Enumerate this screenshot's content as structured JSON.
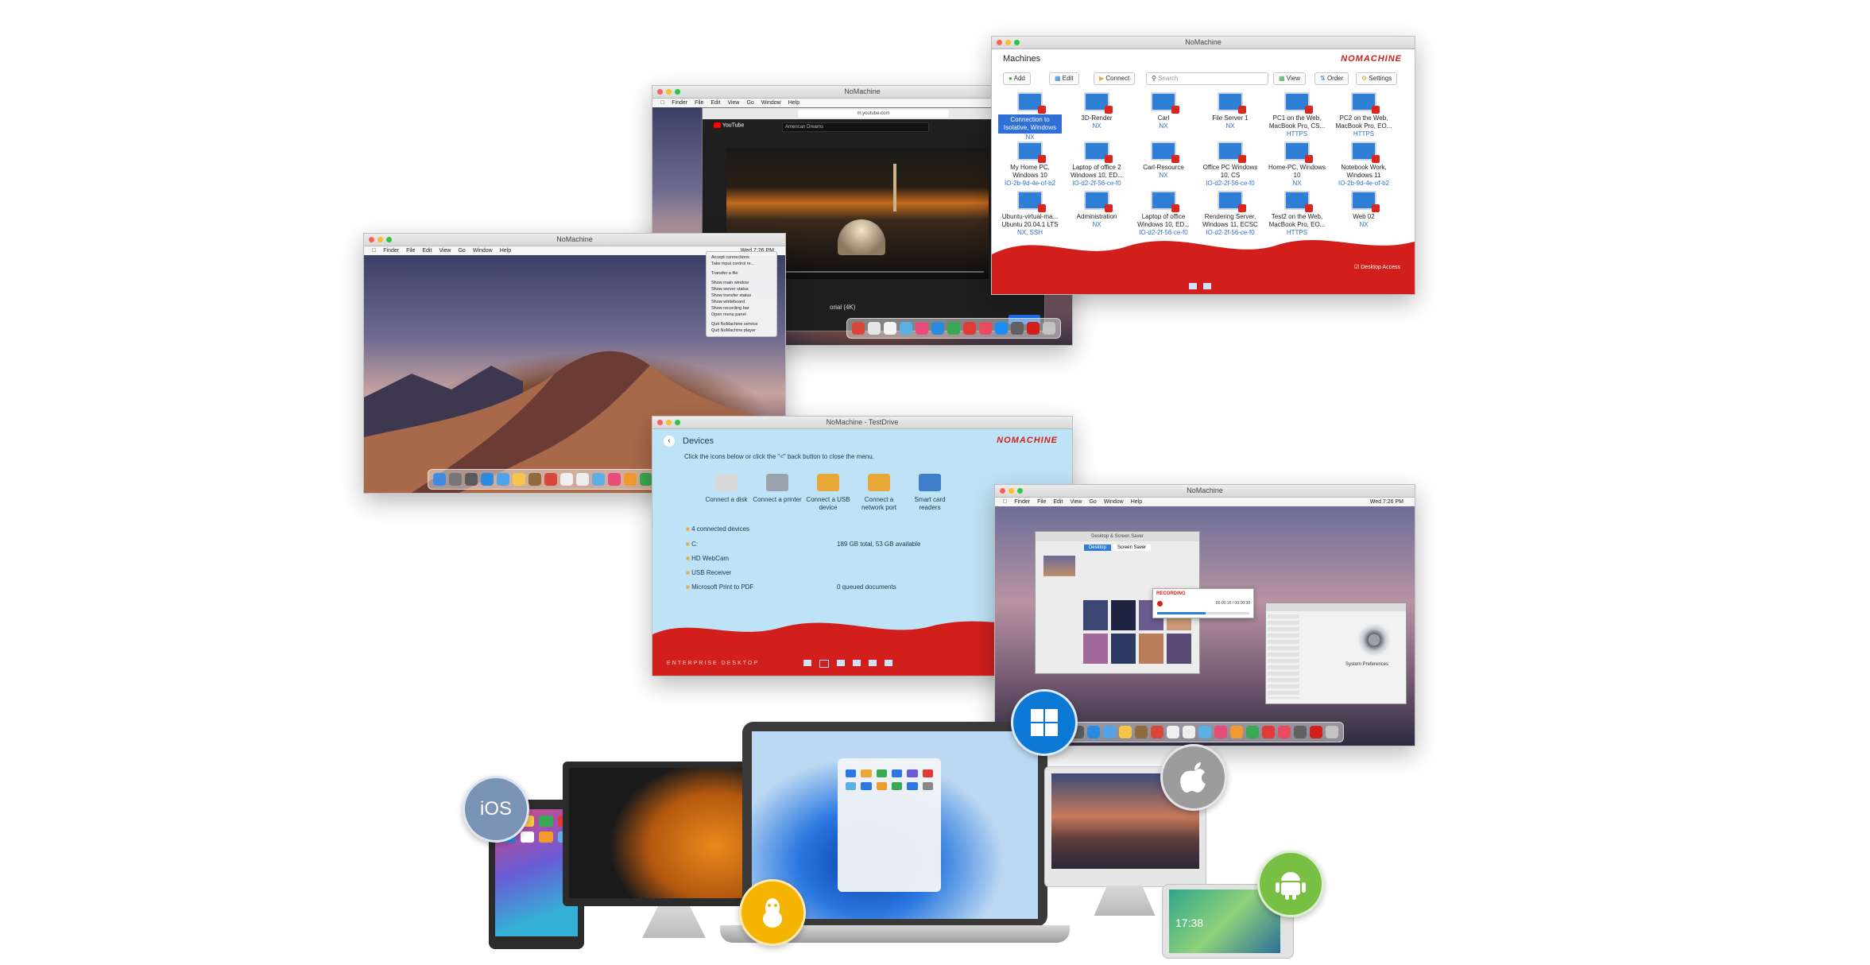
{
  "machines_window": {
    "title": "NoMachine",
    "header": "Machines",
    "brand": "NOMACHINE",
    "toolbar": {
      "add": "Add",
      "edit": "Edit",
      "connect": "Connect",
      "search_placeholder": "Search",
      "view": "View",
      "order": "Order",
      "settings": "Settings"
    },
    "machines": [
      {
        "name": "Connection to Isolative, Windows",
        "info": "NX"
      },
      {
        "name": "3D-Render",
        "info": "NX"
      },
      {
        "name": "Carl",
        "info": "NX"
      },
      {
        "name": "File Server 1",
        "info": "NX"
      },
      {
        "name": "PC1 on the Web, MacBook Pro, CS...",
        "info": "HTTPS"
      },
      {
        "name": "PC2 on the Web, MacBook Pro, EO...",
        "info": "HTTPS"
      },
      {
        "name": "My Home PC, Windows 10",
        "info": "IO-2b-9d-4e-of-b2"
      },
      {
        "name": "Laptop of office 2 Windows 10, ED...",
        "info": "IO-d2-2f-56-ce-f0"
      },
      {
        "name": "Carl-Resource",
        "info": "NX"
      },
      {
        "name": "Office PC Windows 10, CS",
        "info": "IO-d2-2f-56-ce-f0"
      },
      {
        "name": "Home-PC, Windows 10",
        "info": "NX"
      },
      {
        "name": "Notebook Work, Windows 11",
        "info": "IO-2b-9d-4e-of-b2"
      },
      {
        "name": "Ubuntu-virtual-ma... Ubuntu 20.04.1 LTS",
        "info": "NX, SSH"
      },
      {
        "name": "Administration",
        "info": "NX"
      },
      {
        "name": "Laptop of office Windows 10, ED...",
        "info": "IO-d2-2f-56-ce-f0"
      },
      {
        "name": "Rendering Server, Windows 11, ECSC",
        "info": "IO-d2-2f-56-ce-f0"
      },
      {
        "name": "Test2 on the Web, MacBook Pro, EO...",
        "info": "HTTPS"
      },
      {
        "name": "Web 02",
        "info": "NX"
      }
    ],
    "footer_checkbox": "Desktop Access"
  },
  "video_window": {
    "title": "NoMachine",
    "menu": [
      "Finder",
      "File",
      "Edit",
      "View",
      "Go",
      "Window",
      "Help"
    ],
    "url": "m.youtube.com",
    "site": "YouTube",
    "search_text": "American Dreams",
    "caption": "orial (4K)"
  },
  "mojave_window": {
    "title": "NoMachine",
    "menu": [
      "Finder",
      "File",
      "Edit",
      "View",
      "Go",
      "Window",
      "Help"
    ],
    "clock": "Wed 7:26 PM",
    "dropdown": [
      "Accept connections",
      "Take input control re...",
      "Transfer a file",
      "Show main window",
      "Show server status",
      "Show transfer status",
      "Show whiteboard",
      "Show recording bar",
      "Open menu panel",
      "Quit NoMachine service",
      "Quit NoMachine player"
    ]
  },
  "devices_window": {
    "title": "NoMachine - TestDrive",
    "header": "Devices",
    "brand": "NOMACHINE",
    "instruction": "Click the icons below or click the \"<\" back button to close the menu.",
    "devices": [
      {
        "label": "Connect a disk",
        "color": "#d8d8d8"
      },
      {
        "label": "Connect a printer",
        "color": "#9aa3ad"
      },
      {
        "label": "Connect a USB device",
        "color": "#e8a93a"
      },
      {
        "label": "Connect a network port",
        "color": "#e8a93a"
      },
      {
        "label": "Smart card readers",
        "color": "#3f7fc9"
      }
    ],
    "connected_header": "4 connected devices",
    "connected": [
      {
        "name": "C:",
        "detail": "189 GB total, 53 GB available"
      },
      {
        "name": "HD WebCam",
        "detail": ""
      },
      {
        "name": "USB Receiver",
        "detail": ""
      },
      {
        "name": "Microsoft Print to PDF",
        "detail": "0 queued documents"
      }
    ],
    "footer": "ENTERPRISE DESKTOP"
  },
  "recording_window": {
    "title": "NoMachine",
    "menu": [
      "Finder",
      "File",
      "Edit",
      "View",
      "Go",
      "Window",
      "Help"
    ],
    "clock": "Wed 7:26 PM",
    "rec_label": "RECORDING",
    "rec_time": "00:00:16 / 00:00:30",
    "prefs_title": "Desktop & Screen Saver",
    "prefs_tabs": [
      "Desktop",
      "Screen Saver"
    ],
    "sysprefs_label": "System Preferences"
  },
  "platforms": {
    "ios": "iOS",
    "windows": "windows-logo",
    "apple": "apple-logo",
    "linux": "linux-logo",
    "android": "android-logo",
    "tablet_clock": "17:38"
  },
  "colors": {
    "brand_red": "#d21f1b",
    "devices_bg": "#bfe3f6",
    "windows_blue": "#0a78d4",
    "android_green": "#78c043",
    "linux_yellow": "#f4b400"
  }
}
